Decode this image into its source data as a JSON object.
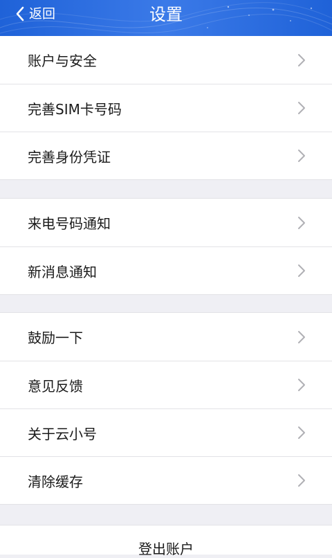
{
  "header": {
    "back_label": "返回",
    "title": "设置"
  },
  "groups": [
    {
      "items": [
        {
          "label": "账户与安全"
        },
        {
          "label": "完善SIM卡号码"
        },
        {
          "label": "完善身份凭证"
        }
      ]
    },
    {
      "items": [
        {
          "label": "来电号码通知"
        },
        {
          "label": "新消息通知"
        }
      ]
    },
    {
      "items": [
        {
          "label": "鼓励一下"
        },
        {
          "label": "意见反馈"
        },
        {
          "label": "关于云小号"
        },
        {
          "label": "清除缓存"
        }
      ]
    }
  ],
  "logout": {
    "label": "登出账户"
  },
  "colors": {
    "header_bg": "#1f62d8",
    "page_bg": "#efeff4",
    "arrow": "#b0b0b5"
  }
}
